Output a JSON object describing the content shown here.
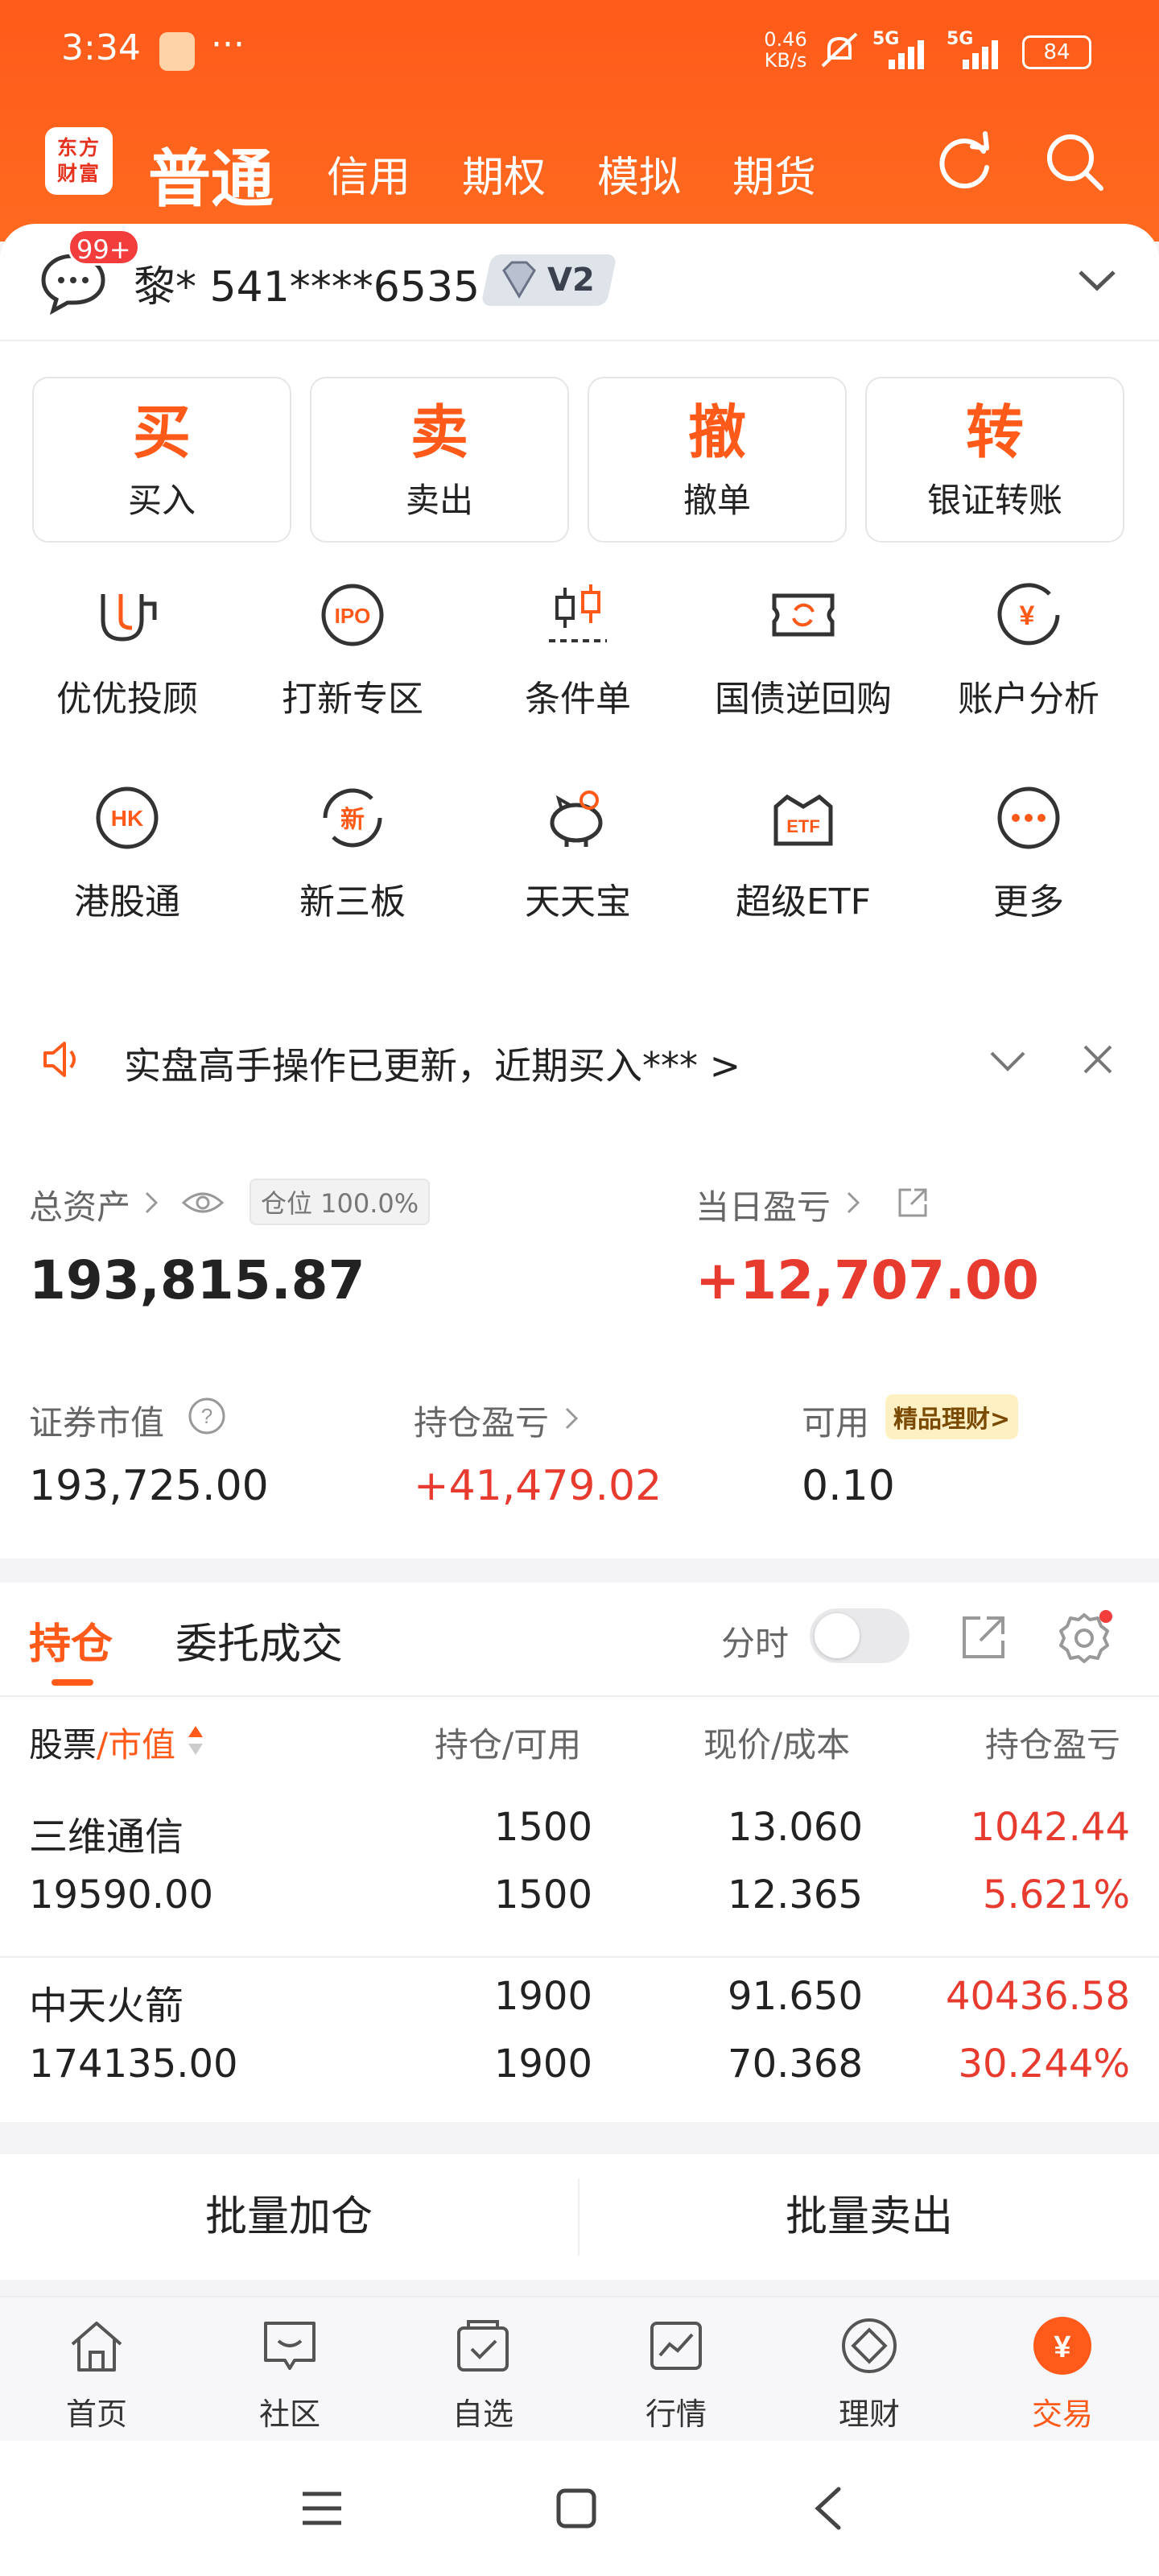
{
  "status_bar": {
    "time": "3:34",
    "more": "···",
    "net_speed_top": "0.46",
    "net_speed_bottom": "KB/s",
    "sig1": "5G",
    "sig2": "5G",
    "battery": "84"
  },
  "header": {
    "logo_line1": "东方",
    "logo_line2": "财富",
    "tabs": [
      "普通",
      "信用",
      "期权",
      "模拟",
      "期货"
    ],
    "active_tab": "普通",
    "accent": "#ff5a1a"
  },
  "account": {
    "msg_badge": "99+",
    "name_masked": "黎* 541****6535",
    "level": "V2"
  },
  "actions": [
    {
      "big": "买",
      "label": "买入"
    },
    {
      "big": "卖",
      "label": "卖出"
    },
    {
      "big": "撤",
      "label": "撤单"
    },
    {
      "big": "转",
      "label": "银证转账"
    }
  ],
  "grid": [
    {
      "label": "优优投顾",
      "icon": "advisor-icon"
    },
    {
      "label": "打新专区",
      "icon": "ipo-icon",
      "icon_text": "IPO"
    },
    {
      "label": "条件单",
      "icon": "candlestick-icon"
    },
    {
      "label": "国债逆回购",
      "icon": "bond-repo-icon"
    },
    {
      "label": "账户分析",
      "icon": "account-analysis-icon",
      "icon_text": "¥"
    },
    {
      "label": "港股通",
      "icon": "hk-connect-icon",
      "icon_text": "HK"
    },
    {
      "label": "新三板",
      "icon": "new-third-board-icon",
      "icon_text": "新"
    },
    {
      "label": "天天宝",
      "icon": "piggy-bank-icon"
    },
    {
      "label": "超级ETF",
      "icon": "etf-icon",
      "icon_text": "ETF"
    },
    {
      "label": "更多",
      "icon": "more-icon",
      "icon_text": "···"
    }
  ],
  "notice": {
    "text": "实盘高手操作已更新，近期买入*** >"
  },
  "assets": {
    "total_label": "总资产",
    "position_chip": "仓位 100.0%",
    "total_value": "193,815.87",
    "daily_pl_label": "当日盈亏",
    "daily_pl_value": "+12,707.00",
    "market_value_label": "证券市值",
    "market_value": "193,725.00",
    "holding_pl_label": "持仓盈亏",
    "holding_pl_value": "+41,479.02",
    "available_label": "可用",
    "wealth_chip": "精品理财>",
    "available_value": "0.10"
  },
  "positions": {
    "tab_holdings": "持仓",
    "tab_orders": "委托成交",
    "fenshi_label": "分时",
    "col_stock": "股票",
    "col_sep": "/",
    "col_mv": "市值",
    "col_qty": "持仓/可用",
    "col_price": "现价/成本",
    "col_pl": "持仓盈亏",
    "rows": [
      {
        "name": "三维通信",
        "mv": "19590.00",
        "qty": "1500",
        "avail": "1500",
        "price": "13.060",
        "cost": "12.365",
        "pl": "1042.44",
        "pl_pct": "5.621%"
      },
      {
        "name": "中天火箭",
        "mv": "174135.00",
        "qty": "1900",
        "avail": "1900",
        "price": "91.650",
        "cost": "70.368",
        "pl": "40436.58",
        "pl_pct": "30.244%"
      }
    ]
  },
  "batch": {
    "add": "批量加仓",
    "sell": "批量卖出"
  },
  "bottom_nav": [
    {
      "label": "首页",
      "icon": "home-icon"
    },
    {
      "label": "社区",
      "icon": "community-icon"
    },
    {
      "label": "自选",
      "icon": "watchlist-icon"
    },
    {
      "label": "行情",
      "icon": "market-icon"
    },
    {
      "label": "理财",
      "icon": "wealth-icon"
    },
    {
      "label": "交易",
      "icon": "trade-icon",
      "icon_text": "¥"
    }
  ]
}
